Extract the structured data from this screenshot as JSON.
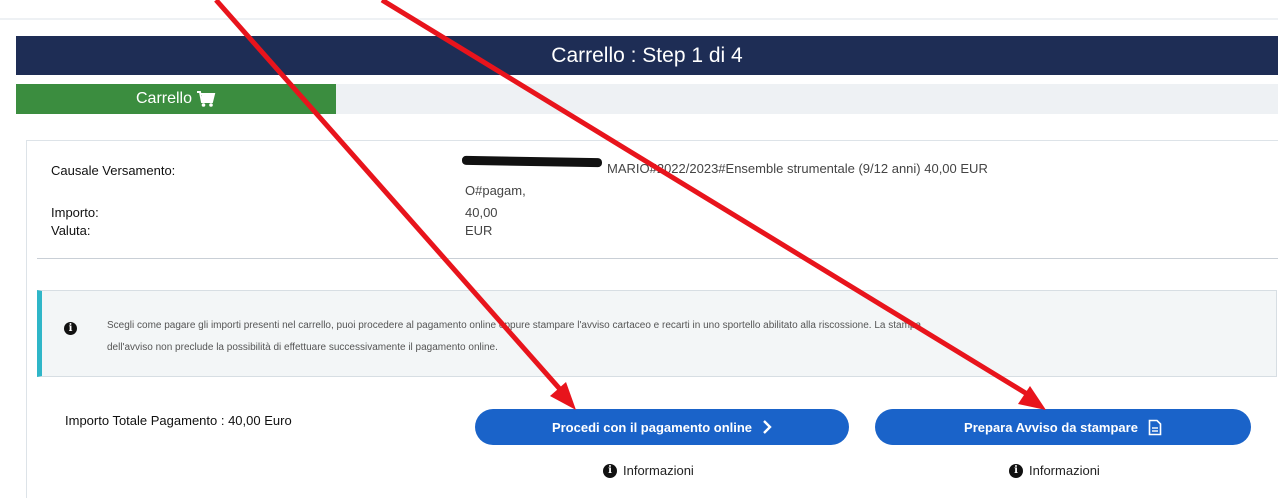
{
  "header": {
    "title": "Carrello : Step 1 di 4"
  },
  "tabs": [
    {
      "label": "Carrello",
      "icon": "cart-icon"
    }
  ],
  "details": {
    "causale_label": "Causale Versamento:",
    "causale_value_line1": "MARIO#2022/2023#Ensemble strumentale (9/12 anni) 40,00 EUR",
    "causale_value_line2": "O#pagam,",
    "importo_label": "Importo:",
    "importo_value": "40,00",
    "valuta_label": "Valuta:",
    "valuta_value": "EUR"
  },
  "info": {
    "icon": "info-icon",
    "line1": "Scegli come pagare gli importi presenti nel carrello, puoi procedere al pagamento online oppure stampare l'avviso cartaceo e recarti in uno sportello abilitato alla riscossione. La stampa",
    "line2": "dell'avviso non preclude la possibilità di effettuare successivamente il pagamento online."
  },
  "summary": {
    "total_label": "Importo Totale Pagamento : 40,00 Euro"
  },
  "actions": {
    "online_label": "Procedi con il pagamento online",
    "print_label": "Prepara Avviso da stampare",
    "info_label": "Informazioni"
  },
  "colors": {
    "title_bar": "#1e2d55",
    "tab_active": "#3b8d3f",
    "button": "#1a63c9",
    "info_accent": "#2fb6c8",
    "annotation_arrow": "#e8141c"
  }
}
